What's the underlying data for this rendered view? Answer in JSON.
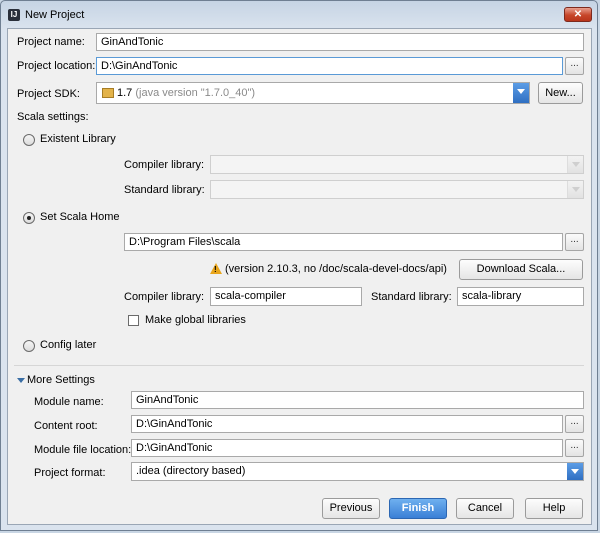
{
  "window": {
    "title": "New Project",
    "close_symbol": "✕"
  },
  "project": {
    "name_label": "Project name:",
    "name_value": "GinAndTonic",
    "location_label": "Project location:",
    "location_value": "D:\\GinAndTonic",
    "sdk_label": "Project SDK:",
    "sdk_version": "1.7",
    "sdk_detail": "(java version \"1.7.0_40\")",
    "sdk_new_button": "New...",
    "browse_symbol": "..."
  },
  "scala": {
    "section_label": "Scala settings:",
    "existent_library_label": "Existent Library",
    "compiler_library_label": "Compiler library:",
    "standard_library_label": "Standard library:",
    "set_scala_home_label": "Set Scala Home",
    "home_path": "D:\\Program Files\\scala",
    "warning_text": "(version 2.10.3, no /doc/scala-devel-docs/api)",
    "download_button": "Download Scala...",
    "compiler_library_value": "scala-compiler",
    "standard_library_value": "scala-library",
    "make_global_label": "Make global libraries",
    "config_later_label": "Config later"
  },
  "more": {
    "section_label": "More Settings",
    "module_name_label": "Module name:",
    "module_name_value": "GinAndTonic",
    "content_root_label": "Content root:",
    "content_root_value": "D:\\GinAndTonic",
    "module_file_label": "Module file location:",
    "module_file_value": "D:\\GinAndTonic",
    "format_label": "Project format:",
    "format_value": ".idea (directory based)"
  },
  "buttons": {
    "previous": "Previous",
    "finish": "Finish",
    "cancel": "Cancel",
    "help": "Help"
  }
}
